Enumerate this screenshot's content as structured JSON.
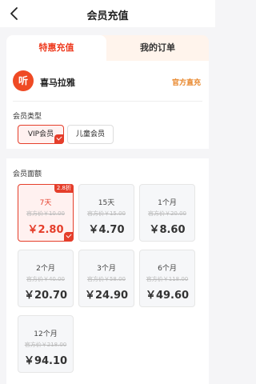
{
  "header": {
    "title": "会员充值"
  },
  "tabs": [
    {
      "label": "特惠充值"
    },
    {
      "label": "我的订单"
    }
  ],
  "brand": {
    "logo_text": "听",
    "name": "喜马拉雅",
    "badge": "官方直充"
  },
  "member_type": {
    "title": "会员类型",
    "options": [
      {
        "label": "VIP会员"
      },
      {
        "label": "儿童会员"
      }
    ]
  },
  "amount": {
    "title": "会员面额",
    "options": [
      {
        "name": "7天",
        "original": "官方价￥10.00",
        "price": "￥2.80",
        "tag": "2.8折"
      },
      {
        "name": "15天",
        "original": "官方价￥15.00",
        "price": "￥4.70"
      },
      {
        "name": "1个月",
        "original": "官方价￥20.00",
        "price": "￥8.60"
      },
      {
        "name": "2个月",
        "original": "官方价￥40.00",
        "price": "￥20.70"
      },
      {
        "name": "3个月",
        "original": "官方价￥58.00",
        "price": "￥24.90"
      },
      {
        "name": "6个月",
        "original": "官方价￥118.00",
        "price": "￥49.60"
      },
      {
        "name": "12个月",
        "original": "官方价￥218.00",
        "price": "￥94.10"
      }
    ]
  },
  "colors": {
    "accent": "#e53e2b",
    "badge": "#e8862a",
    "tab_bg": "#fff4ec"
  },
  "icons": {
    "back": "chevron-left-icon",
    "check": "check-icon"
  }
}
